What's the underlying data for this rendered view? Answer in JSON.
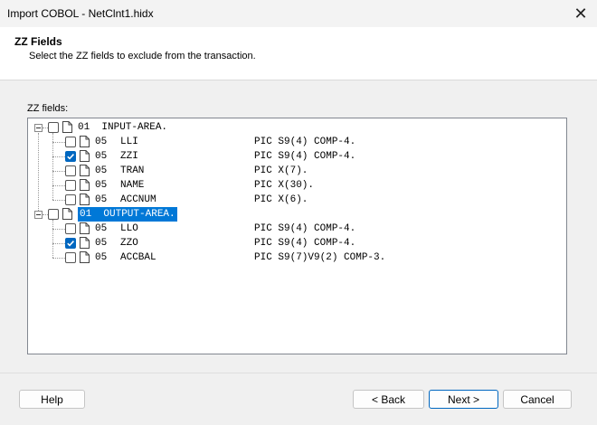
{
  "window": {
    "title": "Import COBOL - NetClnt1.hidx",
    "close_glyph": "✕"
  },
  "header": {
    "title": "ZZ Fields",
    "subtitle": "Select the ZZ fields to exclude from the transaction."
  },
  "tree": {
    "label": "ZZ fields:",
    "groups": [
      {
        "level": "01",
        "name": "INPUT-AREA.",
        "checked": false,
        "selected": false,
        "fields": [
          {
            "level": "05",
            "name": "LLI",
            "pic": "PIC S9(4) COMP-4.",
            "checked": false
          },
          {
            "level": "05",
            "name": "ZZI",
            "pic": "PIC S9(4) COMP-4.",
            "checked": true
          },
          {
            "level": "05",
            "name": "TRAN",
            "pic": "PIC X(7).",
            "checked": false
          },
          {
            "level": "05",
            "name": "NAME",
            "pic": "PIC X(30).",
            "checked": false
          },
          {
            "level": "05",
            "name": "ACCNUM",
            "pic": "PIC X(6).",
            "checked": false
          }
        ]
      },
      {
        "level": "01",
        "name": "OUTPUT-AREA.",
        "checked": false,
        "selected": true,
        "fields": [
          {
            "level": "05",
            "name": "LLO",
            "pic": "PIC S9(4) COMP-4.",
            "checked": false
          },
          {
            "level": "05",
            "name": "ZZO",
            "pic": "PIC S9(4) COMP-4.",
            "checked": true
          },
          {
            "level": "05",
            "name": "ACCBAL",
            "pic": "PIC S9(7)V9(2) COMP-3.",
            "checked": false
          }
        ]
      }
    ]
  },
  "buttons": {
    "help": "Help",
    "back": "< Back",
    "next": "Next >",
    "cancel": "Cancel"
  },
  "colors": {
    "accent": "#0067c0",
    "selection": "#0078d7"
  }
}
